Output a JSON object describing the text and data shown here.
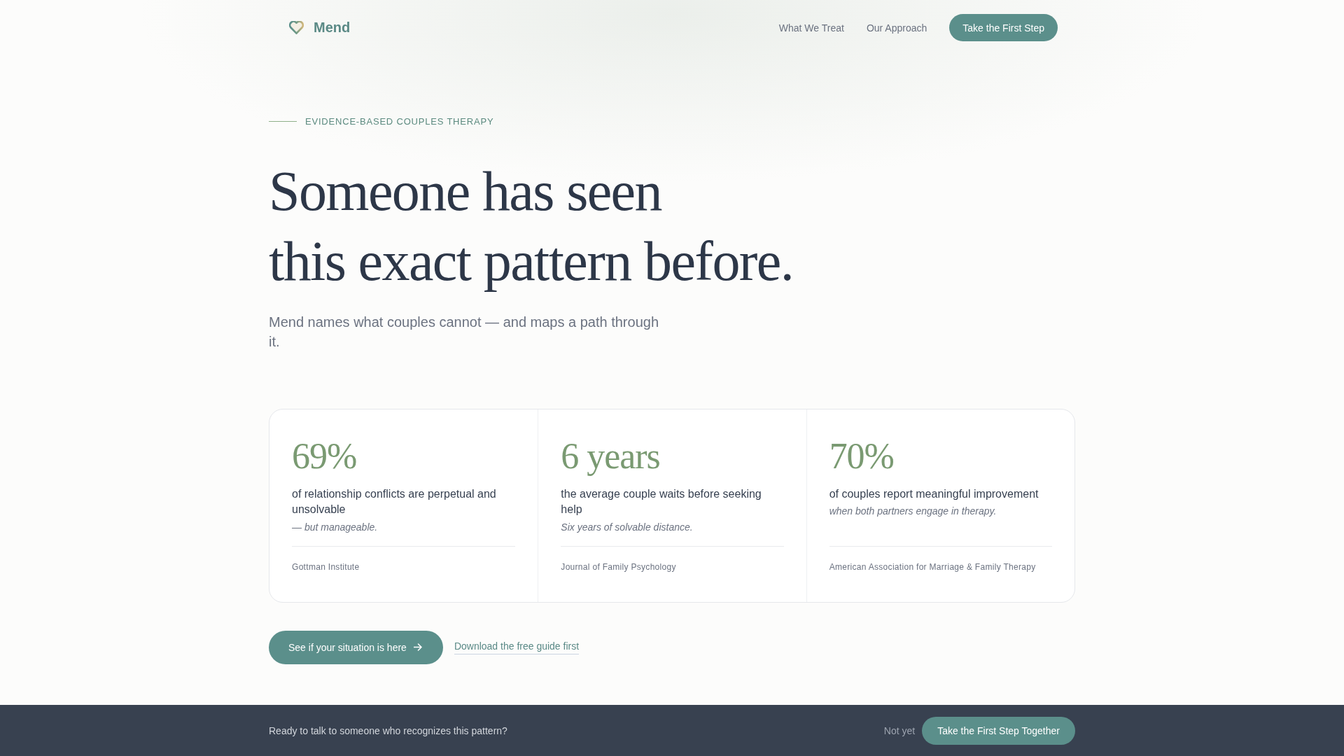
{
  "header": {
    "brand": "Mend",
    "nav": [
      {
        "label": "What We Treat"
      },
      {
        "label": "Our Approach"
      }
    ],
    "cta": "Take the First Step"
  },
  "hero": {
    "eyebrow": "EVIDENCE-BASED COUPLES THERAPY",
    "headline": [
      "Someone has seen",
      "this exact pattern before."
    ],
    "subtitle": "Mend names what couples cannot — and maps a path through it."
  },
  "stats": [
    {
      "value": "69%",
      "description": "of relationship conflicts are perpetual and unsolvable",
      "note": "— but manageable.",
      "source": "Gottman Institute"
    },
    {
      "value": "6 years",
      "description": "the average couple waits before seeking help",
      "note": "Six years of solvable distance.",
      "source": "Journal of Family Psychology"
    },
    {
      "value": "70%",
      "description": "of couples report meaningful improvement",
      "note": "when both partners engage in therapy.",
      "source": "American Association for Marriage & Family Therapy"
    }
  ],
  "actions": {
    "primary": "See if your situation is here",
    "secondary": "Download the free guide first"
  },
  "bottom_bar": {
    "message": "Ready to talk to someone who recognizes this pattern?",
    "dismiss": "Not yet",
    "cta": "Take the First Step Together"
  }
}
